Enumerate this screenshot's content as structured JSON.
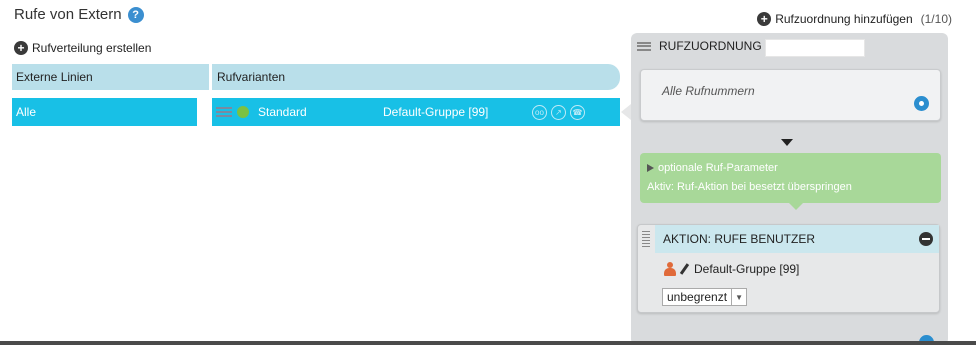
{
  "page": {
    "title": "Rufe von Extern"
  },
  "actions": {
    "create_distribution": "Rufverteilung erstellen",
    "add_assignment": "Rufzuordnung hinzufügen",
    "add_assignment_count": "(1/10)"
  },
  "table": {
    "headers": [
      "Externe Linien",
      "Rufvarianten"
    ],
    "rows": [
      {
        "external_line": "Alle",
        "variant": "Standard",
        "group": "Default-Gruppe [99]"
      }
    ]
  },
  "rufzuordnung": {
    "header": "RUFZUORDNUNG",
    "input_value": "",
    "numbers_card": "Alle Rufnummern",
    "optional_params": {
      "title": "optionale Ruf-Parameter",
      "status": "Aktiv: Ruf-Aktion bei besetzt überspringen"
    },
    "action": {
      "title": "AKTION: RUFE BENUTZER",
      "target": "Default-Gruppe [99]",
      "select_value": "unbegrenzt"
    }
  },
  "colors": {
    "row_selected": "#18c0e6",
    "header_bg": "#b9dfea",
    "param_bg": "#a8d899",
    "accent_blue": "#2b8ecf"
  }
}
